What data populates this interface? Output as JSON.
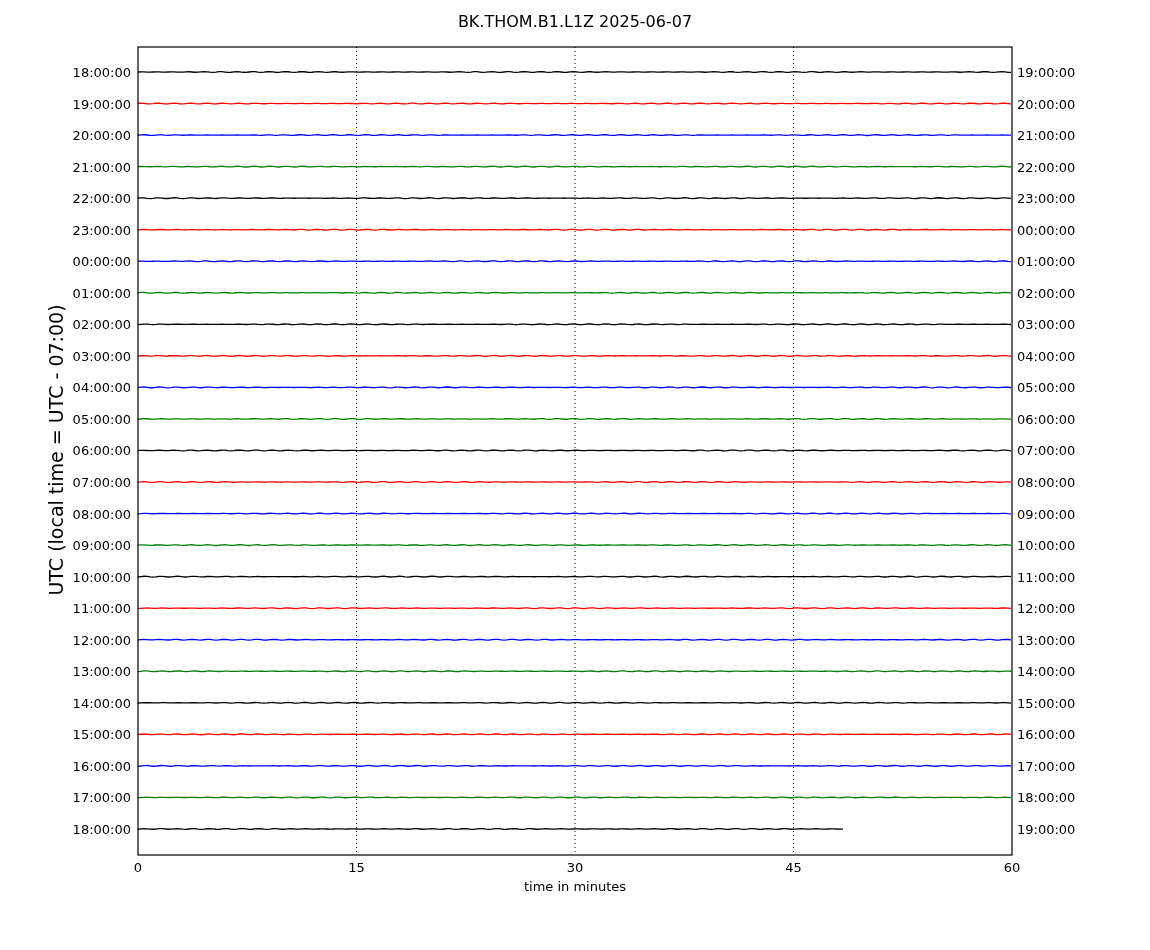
{
  "title": "BK.THOM.B1.L1Z 2025-06-07",
  "ylabel": "UTC (local time = UTC - 07:00)",
  "xlabel": "time in minutes",
  "xticks": [
    "0",
    "15",
    "30",
    "45",
    "60"
  ],
  "rows": [
    {
      "left": "18:00:00",
      "right": "19:00:00",
      "color": "#000000",
      "level": 1
    },
    {
      "left": "19:00:00",
      "right": "20:00:00",
      "color": "#ff0000",
      "level": 1
    },
    {
      "left": "20:00:00",
      "right": "21:00:00",
      "color": "#0000ff",
      "level": 1
    },
    {
      "left": "21:00:00",
      "right": "22:00:00",
      "color": "#008000",
      "level": 1
    },
    {
      "left": "22:00:00",
      "right": "23:00:00",
      "color": "#000000",
      "level": 1
    },
    {
      "left": "23:00:00",
      "right": "00:00:00",
      "color": "#ff0000",
      "level": 1
    },
    {
      "left": "00:00:00",
      "right": "01:00:00",
      "color": "#0000ff",
      "level": 1
    },
    {
      "left": "01:00:00",
      "right": "02:00:00",
      "color": "#008000",
      "level": 1
    },
    {
      "left": "02:00:00",
      "right": "03:00:00",
      "color": "#000000",
      "level": 1
    },
    {
      "left": "03:00:00",
      "right": "04:00:00",
      "color": "#ff0000",
      "level": 1
    },
    {
      "left": "04:00:00",
      "right": "05:00:00",
      "color": "#0000ff",
      "level": 1
    },
    {
      "left": "05:00:00",
      "right": "06:00:00",
      "color": "#008000",
      "level": 1
    },
    {
      "left": "06:00:00",
      "right": "07:00:00",
      "color": "#000000",
      "level": 1
    },
    {
      "left": "07:00:00",
      "right": "08:00:00",
      "color": "#ff0000",
      "level": 1
    },
    {
      "left": "08:00:00",
      "right": "09:00:00",
      "color": "#0000ff",
      "level": 1
    },
    {
      "left": "09:00:00",
      "right": "10:00:00",
      "color": "#008000",
      "level": 1
    },
    {
      "left": "10:00:00",
      "right": "11:00:00",
      "color": "#000000",
      "level": 1
    },
    {
      "left": "11:00:00",
      "right": "12:00:00",
      "color": "#ff0000",
      "level": 1
    },
    {
      "left": "12:00:00",
      "right": "13:00:00",
      "color": "#0000ff",
      "level": 1
    },
    {
      "left": "13:00:00",
      "right": "14:00:00",
      "color": "#008000",
      "level": 1
    },
    {
      "left": "14:00:00",
      "right": "15:00:00",
      "color": "#000000",
      "level": 1
    },
    {
      "left": "15:00:00",
      "right": "16:00:00",
      "color": "#ff0000",
      "level": 1
    },
    {
      "left": "16:00:00",
      "right": "17:00:00",
      "color": "#0000ff",
      "level": 1
    },
    {
      "left": "17:00:00",
      "right": "18:00:00",
      "color": "#008000",
      "level": 1
    },
    {
      "left": "18:00:00",
      "right": "19:00:00",
      "color": "#000000",
      "level": 0.81
    }
  ]
}
